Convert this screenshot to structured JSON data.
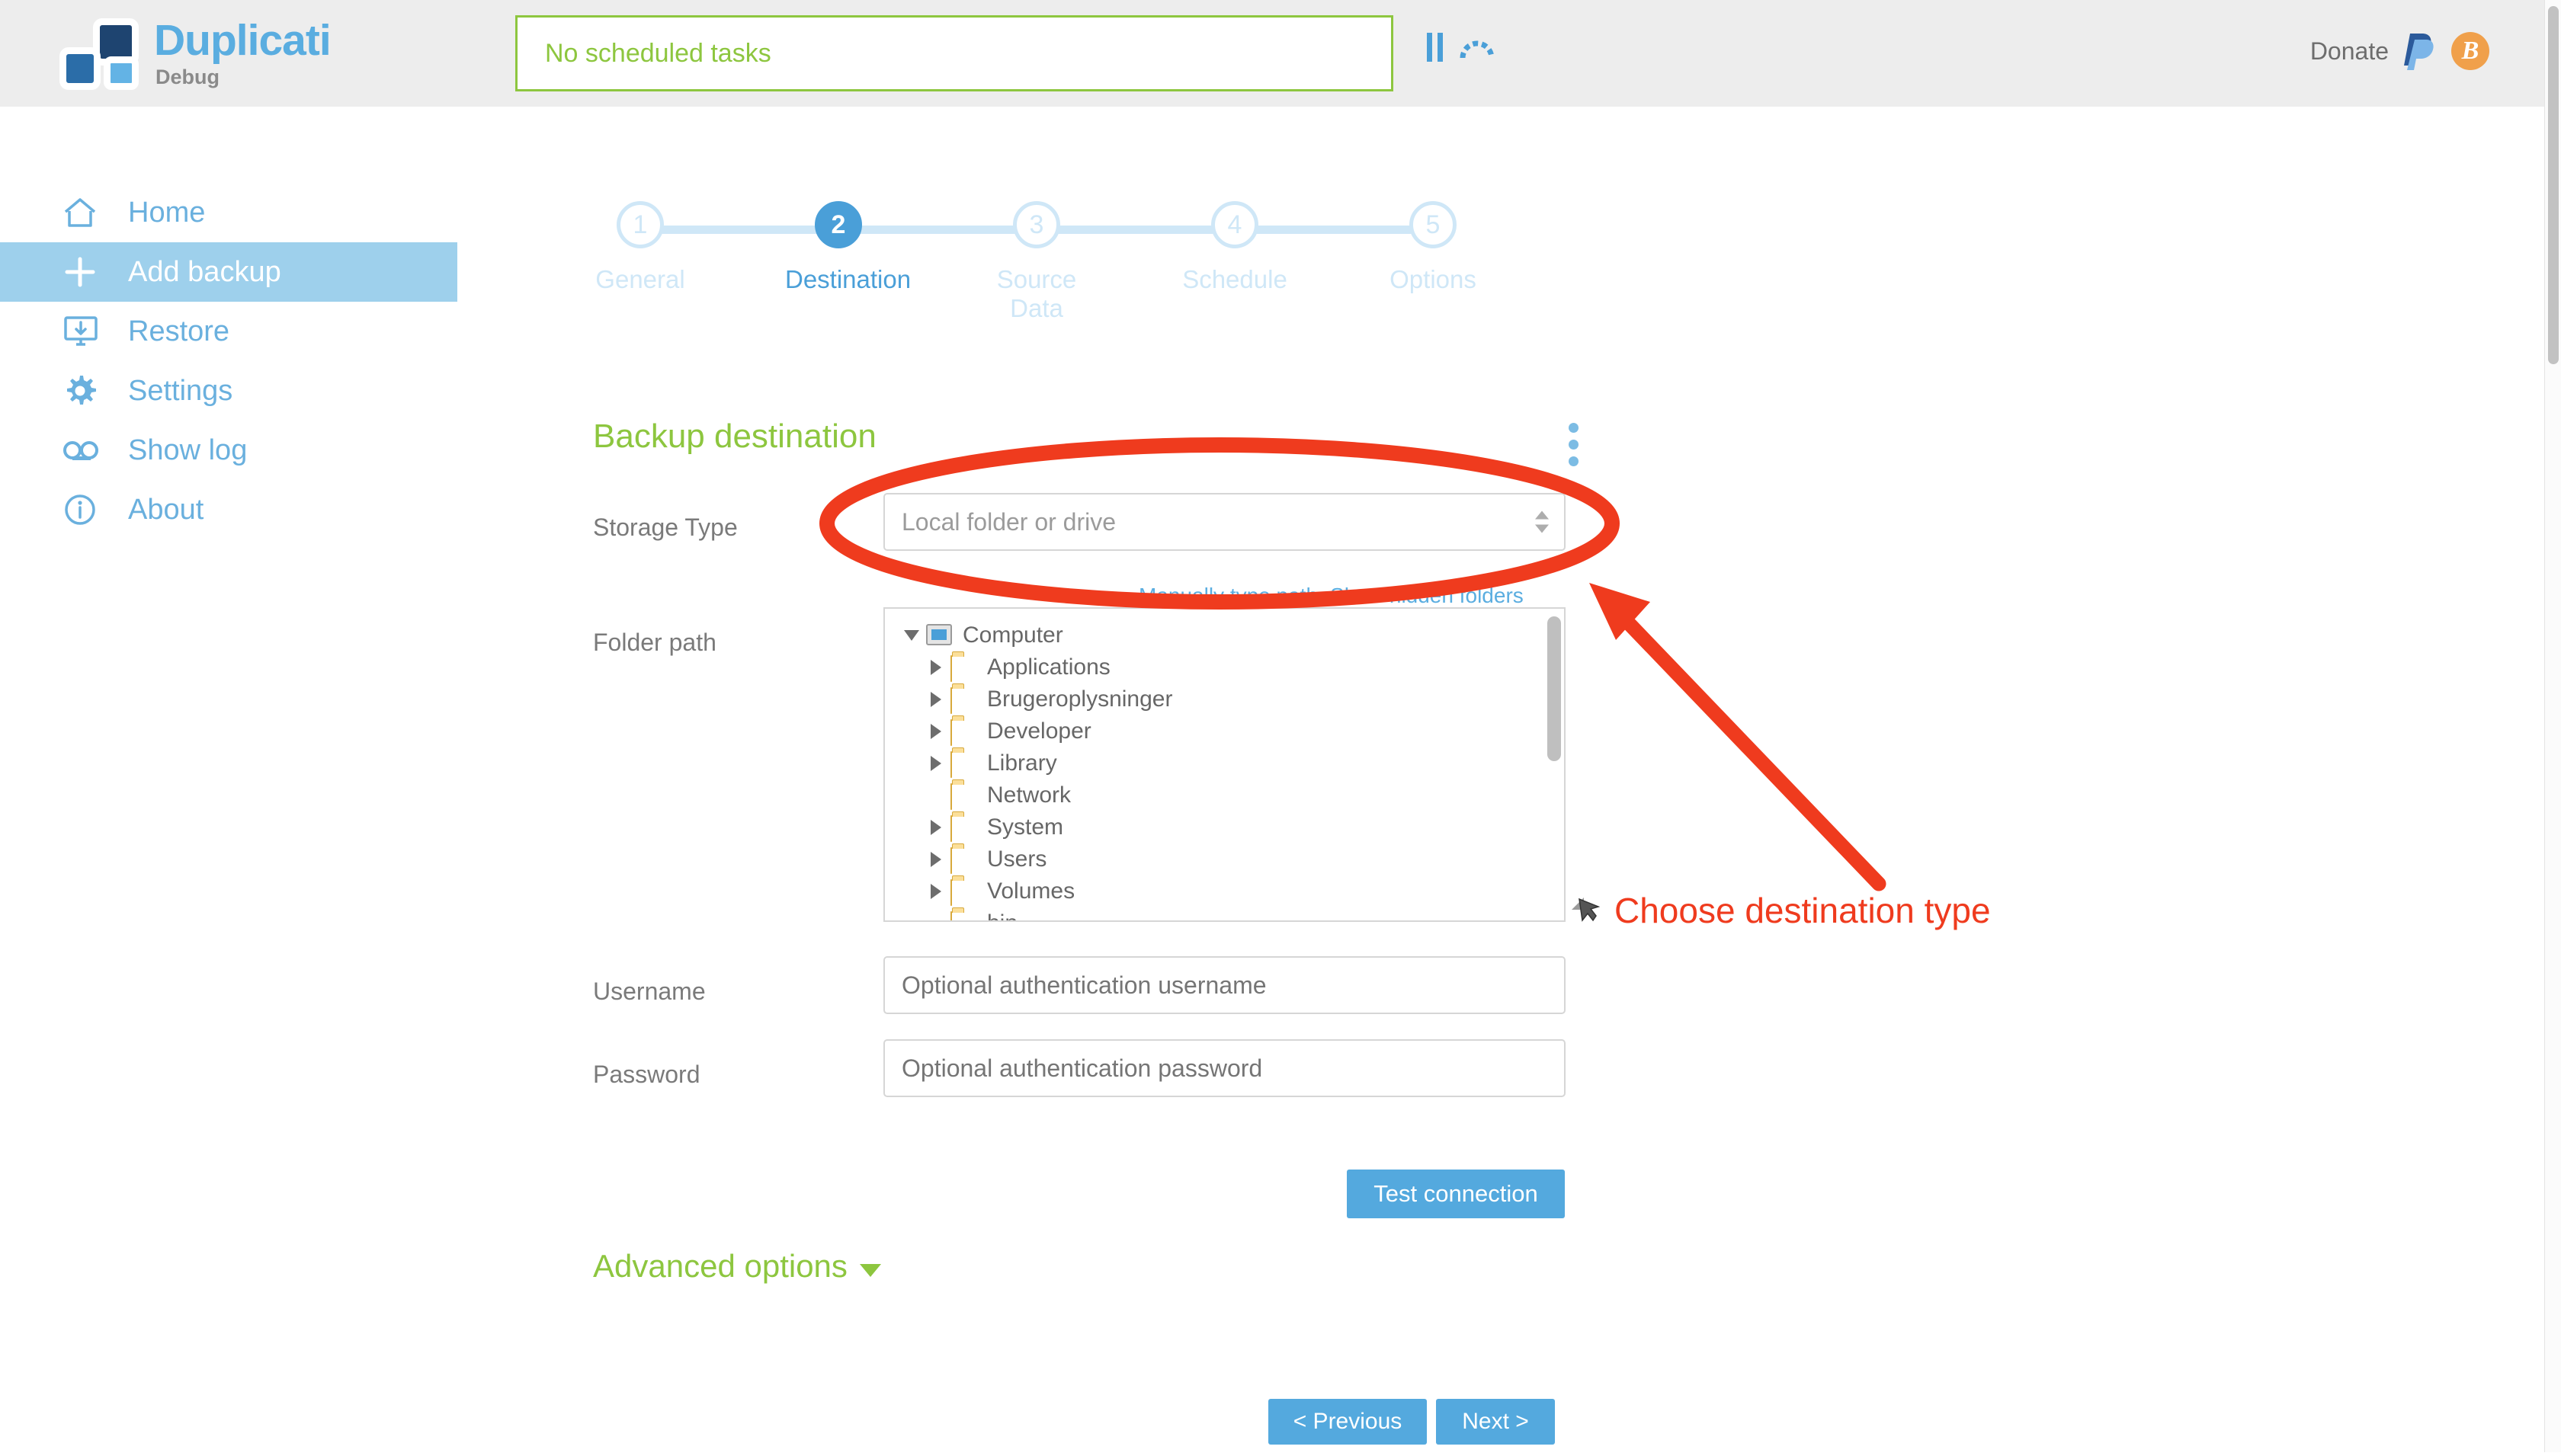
{
  "header": {
    "app_title": "Duplicati",
    "app_subtitle": "Debug",
    "logo_icon": "duplicati-logo-icon",
    "status_text": "No scheduled tasks",
    "pause_icon": "pause-icon",
    "throttle_icon": "throttle-icon",
    "donate_label": "Donate",
    "paypal_icon": "paypal-icon",
    "bitcoin_icon": "bitcoin-icon",
    "bitcoin_glyph": "B",
    "background_color": "#ededed",
    "status_border_color": "#8dc63f"
  },
  "sidebar": {
    "items": [
      {
        "label": "Home",
        "icon": "home-icon",
        "active": false
      },
      {
        "label": "Add backup",
        "icon": "plus-icon",
        "active": true
      },
      {
        "label": "Restore",
        "icon": "restore-icon",
        "active": false
      },
      {
        "label": "Settings",
        "icon": "gear-icon",
        "active": false
      },
      {
        "label": "Show log",
        "icon": "log-icon",
        "active": false
      },
      {
        "label": "About",
        "icon": "info-icon",
        "active": false
      }
    ],
    "active_background": "#9ed0ec",
    "link_color": "#6ab0de"
  },
  "wizard": {
    "current_step": 2,
    "steps": [
      {
        "number": "1",
        "label": "General"
      },
      {
        "number": "2",
        "label": "Destination"
      },
      {
        "number": "3",
        "label": "Source Data"
      },
      {
        "number": "4",
        "label": "Schedule"
      },
      {
        "number": "5",
        "label": "Options"
      }
    ],
    "active_color": "#4a9fd8",
    "inactive_color": "#cfe7f7"
  },
  "main": {
    "section_title": "Backup destination",
    "section_title_color": "#8dc63f",
    "kebab_icon": "more-vertical-icon",
    "storage_type": {
      "label": "Storage Type",
      "value": "Local folder or drive",
      "spinner_icon": "spinner-arrows-icon"
    },
    "tree_links": {
      "manually_type_path": "Manually type path",
      "show_hidden_folders": "Show hidden folders"
    },
    "folder_path": {
      "label": "Folder path",
      "resize_icon": "resize-handle-icon",
      "scrollbar_icon": "vertical-scrollbar",
      "tree": [
        {
          "name": "Computer",
          "icon": "computer-icon",
          "indent": 0,
          "caret": "down",
          "clipped": false
        },
        {
          "name": "Applications",
          "icon": "folder-icon",
          "indent": 1,
          "caret": "right",
          "clipped": false
        },
        {
          "name": "Brugeroplysninger",
          "icon": "folder-icon",
          "indent": 1,
          "caret": "right",
          "clipped": false
        },
        {
          "name": "Developer",
          "icon": "folder-icon",
          "indent": 1,
          "caret": "right",
          "clipped": false
        },
        {
          "name": "Library",
          "icon": "folder-icon",
          "indent": 1,
          "caret": "right",
          "clipped": false
        },
        {
          "name": "Network",
          "icon": "folder-icon",
          "indent": 1,
          "caret": "none",
          "clipped": false
        },
        {
          "name": "System",
          "icon": "folder-icon",
          "indent": 1,
          "caret": "right",
          "clipped": false
        },
        {
          "name": "Users",
          "icon": "folder-icon",
          "indent": 1,
          "caret": "right",
          "clipped": false
        },
        {
          "name": "Volumes",
          "icon": "folder-icon",
          "indent": 1,
          "caret": "right",
          "clipped": false
        },
        {
          "name": "bin",
          "icon": "folder-icon",
          "indent": 1,
          "caret": "none",
          "clipped": true
        }
      ]
    },
    "username": {
      "label": "Username",
      "value": "",
      "placeholder": "Optional authentication username"
    },
    "password": {
      "label": "Password",
      "value": "",
      "placeholder": "Optional authentication password"
    },
    "test_connection_label": "Test connection",
    "advanced_options_label": "Advanced options",
    "advanced_caret_icon": "chevron-down-icon",
    "previous_label": "< Previous",
    "next_label": "Next >",
    "button_color": "#54a9de"
  },
  "annotations": {
    "ellipse_icon": "red-ellipse-highlight",
    "arrow_icon": "red-arrow-icon",
    "callout_text": "Choose destination type",
    "color": "#ef3b1e"
  }
}
